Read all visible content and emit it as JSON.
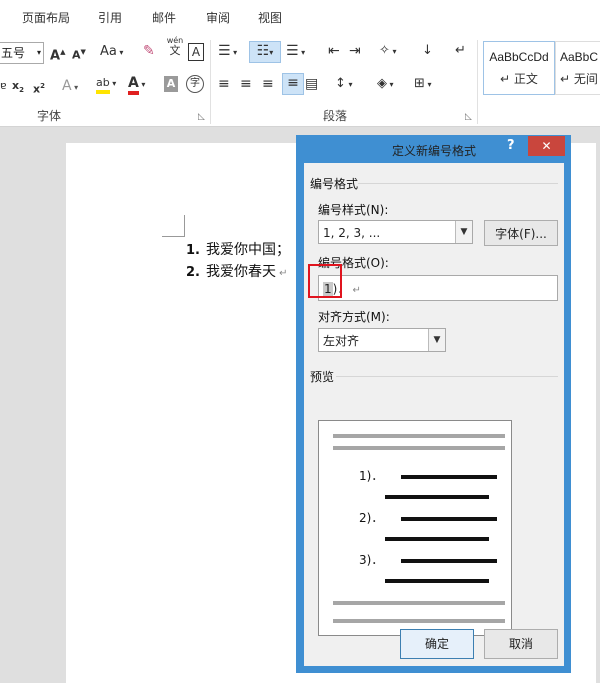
{
  "tabs": [
    "页面布局",
    "引用",
    "邮件",
    "审阅",
    "视图"
  ],
  "font_group": {
    "label": "字体",
    "font_size": "五号",
    "grow": "A",
    "shrink": "A",
    "case": "Aa",
    "phonetic_top": "wén",
    "phonetic_bottom": "文",
    "border_char": "A",
    "text_effect": "A",
    "highlight": "ab",
    "font_color": "A",
    "char_shading": "A",
    "enclose": "字"
  },
  "paragraph_group": {
    "label": "段落"
  },
  "styles": [
    {
      "sample": "AaBbCcDd",
      "name": "正文"
    },
    {
      "sample": "AaBbC",
      "name": "无间"
    }
  ],
  "document": {
    "items": [
      {
        "num": "1.",
        "text": "我爱你中国；"
      },
      {
        "num": "2.",
        "text": "我爱你春天"
      }
    ]
  },
  "dialog": {
    "title": "定义新编号格式",
    "help": "?",
    "close": "✕",
    "section_number_format": "编号格式",
    "style_label": "编号样式(N):",
    "style_value": "1, 2, 3, ...",
    "font_button": "字体(F)...",
    "format_label": "编号格式(O):",
    "format_value_num": "1",
    "format_value_rest": ")．",
    "align_label": "对齐方式(M):",
    "align_value": "左对齐",
    "preview_label": "预览",
    "preview_nums": [
      "1)．",
      "2)．",
      "3)．"
    ],
    "ok": "确定",
    "cancel": "取消"
  },
  "colors": {
    "accent": "#3f8fd2",
    "close_red": "#c9463d",
    "highlight_yellow": "#ffe400",
    "font_red": "#e02020"
  }
}
